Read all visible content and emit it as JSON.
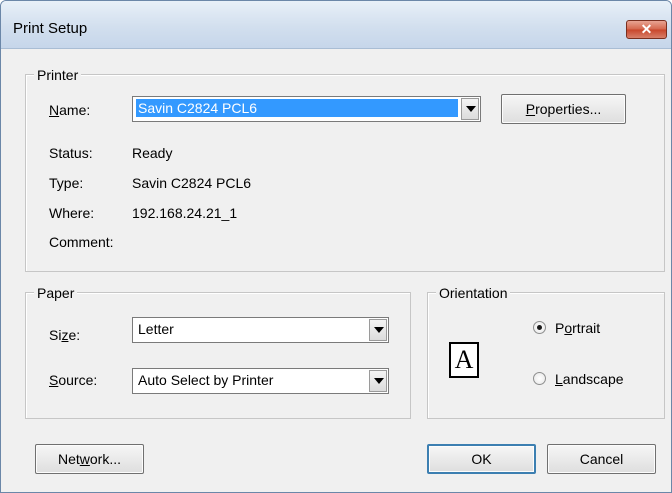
{
  "window": {
    "title": "Print Setup",
    "close_glyph": "✕"
  },
  "printer": {
    "group_label": "Printer",
    "name_label_pre": "",
    "name_label_key": "N",
    "name_label_post": "ame:",
    "name_value": "Savin C2824 PCL6",
    "properties_pre": "",
    "properties_key": "P",
    "properties_post": "roperties...",
    "status_label": "Status:",
    "status_value": "Ready",
    "type_label": "Type:",
    "type_value": "Savin C2824 PCL6",
    "where_label": "Where:",
    "where_value": "192.168.24.21_1",
    "comment_label": "Comment:",
    "comment_value": ""
  },
  "paper": {
    "group_label": "Paper",
    "size_label_pre": "Si",
    "size_label_key": "z",
    "size_label_post": "e:",
    "size_value": "Letter",
    "source_label_pre": "",
    "source_label_key": "S",
    "source_label_post": "ource:",
    "source_value": "Auto Select by Printer"
  },
  "orientation": {
    "group_label": "Orientation",
    "page_glyph": "A",
    "portrait_pre": "P",
    "portrait_key": "o",
    "portrait_post": "rtrait",
    "landscape_pre": "",
    "landscape_key": "L",
    "landscape_post": "andscape",
    "selected": "Portrait"
  },
  "buttons": {
    "network_pre": "Net",
    "network_key": "w",
    "network_post": "ork...",
    "ok": "OK",
    "cancel": "Cancel"
  }
}
